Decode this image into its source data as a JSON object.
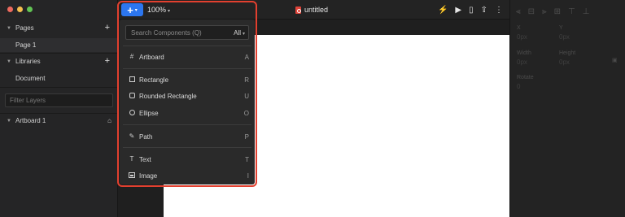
{
  "sidebar": {
    "pages_header": "Pages",
    "pages": [
      {
        "label": "Page 1"
      }
    ],
    "libraries_header": "Libraries",
    "libraries": [
      {
        "label": "Document"
      }
    ],
    "filter_placeholder": "Filter Layers",
    "layers": [
      {
        "label": "Artboard 1"
      }
    ]
  },
  "toolbar": {
    "zoom": "100%",
    "document_title": "untitled"
  },
  "insert_menu": {
    "search_placeholder": "Search Components (Q)",
    "filter_value": "All",
    "items": [
      {
        "label": "Artboard",
        "shortcut": "A",
        "icon": "artboard-icon"
      },
      {
        "label": "Rectangle",
        "shortcut": "R",
        "icon": "rectangle-icon"
      },
      {
        "label": "Rounded Rectangle",
        "shortcut": "U",
        "icon": "rounded-rectangle-icon"
      },
      {
        "label": "Ellipse",
        "shortcut": "O",
        "icon": "ellipse-icon"
      },
      {
        "label": "Path",
        "shortcut": "P",
        "icon": "path-icon"
      },
      {
        "label": "Text",
        "shortcut": "T",
        "icon": "text-icon"
      },
      {
        "label": "Image",
        "shortcut": "I",
        "icon": "image-icon"
      }
    ]
  },
  "inspector": {
    "x_label": "X",
    "x_value": "0px",
    "y_label": "Y",
    "y_value": "0px",
    "width_label": "Width",
    "width_value": "0px",
    "height_label": "Height",
    "height_value": "0px",
    "rotate_label": "Rotate",
    "rotate_value": "0"
  },
  "colors": {
    "accent": "#2c76ef",
    "highlight_frame": "#e2402f",
    "artboard": "#ffffff"
  }
}
